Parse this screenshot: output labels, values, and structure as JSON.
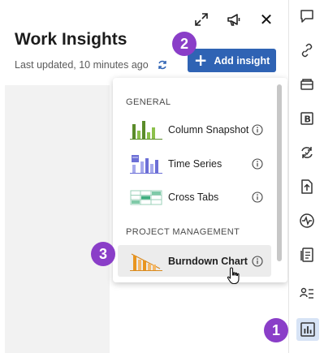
{
  "header": {
    "title": "Work Insights",
    "last_updated": "Last updated, 10 minutes ago",
    "add_button_label": "Add insight"
  },
  "badges": {
    "one": "1",
    "two": "2",
    "three": "3"
  },
  "dropdown": {
    "sections": [
      {
        "header": "GENERAL",
        "items": [
          {
            "label": "Column Snapshot",
            "icon": "column-snapshot-thumbnail"
          },
          {
            "label": "Time Series",
            "icon": "time-series-thumbnail"
          },
          {
            "label": "Cross Tabs",
            "icon": "cross-tabs-thumbnail"
          }
        ]
      },
      {
        "header": "PROJECT MANAGEMENT",
        "items": [
          {
            "label": "Burndown Chart",
            "icon": "burndown-chart-thumbnail",
            "hovered": true
          }
        ]
      }
    ]
  },
  "rail": {
    "icons": [
      "comment-icon",
      "link-icon",
      "wallet-icon",
      "bold-b-icon",
      "sync-icon",
      "upload-icon",
      "activity-icon",
      "form-icon",
      "people-list-icon",
      "insights-chart-icon"
    ],
    "active": "insights-chart-icon"
  },
  "colors": {
    "accent": "#2f63b4",
    "badge": "#8a3ec8",
    "rail_active_bg": "#d7e3f5"
  }
}
